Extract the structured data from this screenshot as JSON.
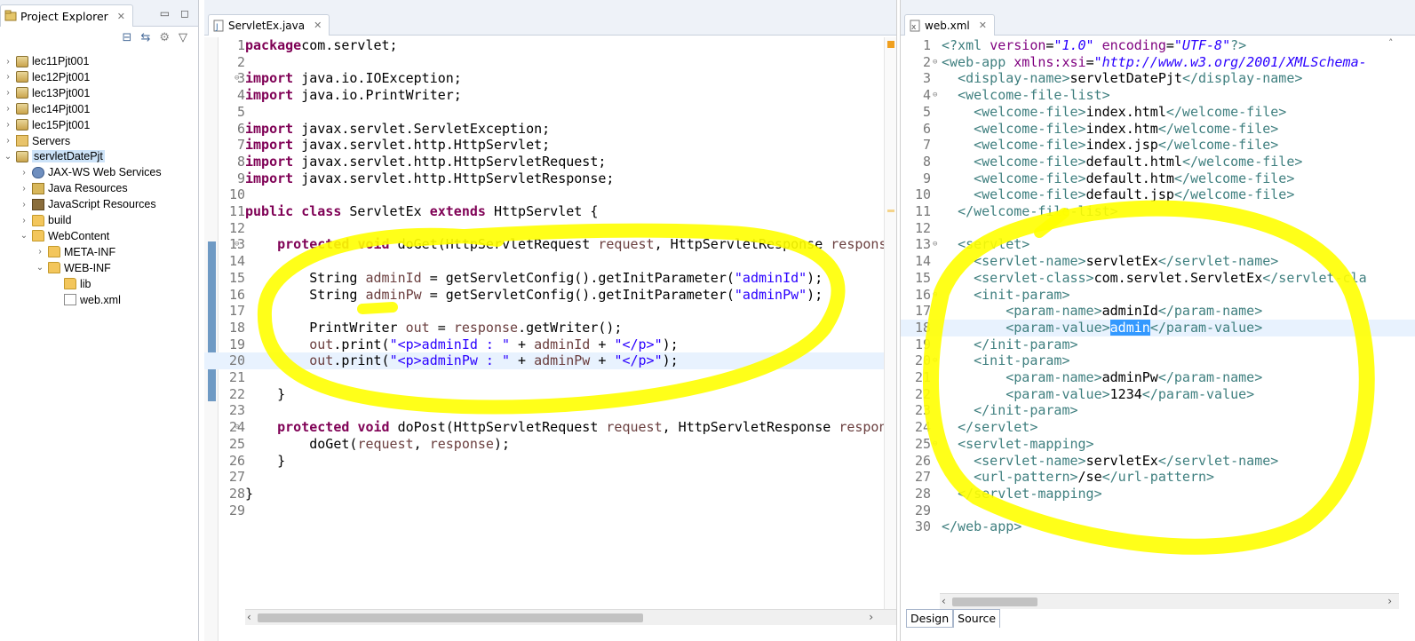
{
  "explorer": {
    "title": "Project Explorer",
    "items": [
      {
        "label": "lec11Pjt001",
        "arrow": ">",
        "icon": "project",
        "level": 0
      },
      {
        "label": "lec12Pjt001",
        "arrow": ">",
        "icon": "project",
        "level": 0
      },
      {
        "label": "lec13Pjt001",
        "arrow": ">",
        "icon": "project",
        "level": 0
      },
      {
        "label": "lec14Pjt001",
        "arrow": ">",
        "icon": "project",
        "level": 0
      },
      {
        "label": "lec15Pjt001",
        "arrow": ">",
        "icon": "project",
        "level": 0
      },
      {
        "label": "Servers",
        "arrow": ">",
        "icon": "servers",
        "level": 0
      },
      {
        "label": "servletDatePjt",
        "arrow": "v",
        "icon": "project",
        "level": 0,
        "selected": true
      },
      {
        "label": "JAX-WS Web Services",
        "arrow": ">",
        "icon": "jaxws",
        "level": 1
      },
      {
        "label": "Java Resources",
        "arrow": ">",
        "icon": "javares",
        "level": 1
      },
      {
        "label": "JavaScript Resources",
        "arrow": ">",
        "icon": "jsres",
        "level": 1
      },
      {
        "label": "build",
        "arrow": ">",
        "icon": "folder",
        "level": 1
      },
      {
        "label": "WebContent",
        "arrow": "v",
        "icon": "folder",
        "level": 1
      },
      {
        "label": "META-INF",
        "arrow": ">",
        "icon": "folder",
        "level": 2
      },
      {
        "label": "WEB-INF",
        "arrow": "v",
        "icon": "folder",
        "level": 2
      },
      {
        "label": "lib",
        "arrow": "",
        "icon": "folder",
        "level": 3
      },
      {
        "label": "web.xml",
        "arrow": "",
        "icon": "xmlfile",
        "level": 3
      }
    ]
  },
  "java_editor": {
    "tab_label": "ServletEx.java",
    "current_line": 20,
    "lines": [
      {
        "n": "1",
        "parts": [
          [
            "kw",
            "package"
          ],
          [
            "",
            "com.servlet;"
          ]
        ]
      },
      {
        "n": "2",
        "parts": []
      },
      {
        "n": "3",
        "fold": "⊖",
        "parts": [
          [
            "kw",
            "import"
          ],
          [
            "",
            " java.io.IOException;"
          ]
        ]
      },
      {
        "n": "4",
        "parts": [
          [
            "kw",
            "import"
          ],
          [
            "",
            " java.io.PrintWriter;"
          ]
        ]
      },
      {
        "n": "5",
        "parts": []
      },
      {
        "n": "6",
        "parts": [
          [
            "kw",
            "import"
          ],
          [
            "",
            " javax.servlet.ServletException;"
          ]
        ]
      },
      {
        "n": "7",
        "parts": [
          [
            "kw",
            "import"
          ],
          [
            "",
            " javax.servlet.http.HttpServlet;"
          ]
        ]
      },
      {
        "n": "8",
        "parts": [
          [
            "kw",
            "import"
          ],
          [
            "",
            " javax.servlet.http.HttpServletRequest;"
          ]
        ]
      },
      {
        "n": "9",
        "parts": [
          [
            "kw",
            "import"
          ],
          [
            "",
            " javax.servlet.http.HttpServletResponse;"
          ]
        ]
      },
      {
        "n": "10",
        "parts": []
      },
      {
        "n": "11",
        "parts": [
          [
            "kw",
            "public"
          ],
          [
            "",
            " "
          ],
          [
            "kw",
            "class"
          ],
          [
            "",
            " ServletEx "
          ],
          [
            "kw",
            "extends"
          ],
          [
            "",
            " HttpServlet {"
          ]
        ]
      },
      {
        "n": "12",
        "parts": []
      },
      {
        "n": "13",
        "fold": "⊖",
        "parts": [
          [
            "",
            "    "
          ],
          [
            "kw",
            "protected"
          ],
          [
            "",
            " "
          ],
          [
            "kw",
            "void"
          ],
          [
            "",
            " doGet(HttpServletRequest "
          ],
          [
            "var",
            "request"
          ],
          [
            "",
            ", HttpServletResponse "
          ],
          [
            "var",
            "respons"
          ]
        ]
      },
      {
        "n": "14",
        "parts": []
      },
      {
        "n": "15",
        "parts": [
          [
            "",
            "        String "
          ],
          [
            "var",
            "adminId"
          ],
          [
            "",
            " = getServletConfig().getInitParameter("
          ],
          [
            "str",
            "\"adminId\""
          ],
          [
            "",
            ");"
          ]
        ]
      },
      {
        "n": "16",
        "parts": [
          [
            "",
            "        String "
          ],
          [
            "var",
            "adminPw"
          ],
          [
            "",
            " = getServletConfig().getInitParameter("
          ],
          [
            "str",
            "\"adminPw\""
          ],
          [
            "",
            ");"
          ]
        ]
      },
      {
        "n": "17",
        "parts": []
      },
      {
        "n": "18",
        "parts": [
          [
            "",
            "        PrintWriter "
          ],
          [
            "var",
            "out"
          ],
          [
            "",
            " = "
          ],
          [
            "var",
            "response"
          ],
          [
            "",
            ".getWriter();"
          ]
        ]
      },
      {
        "n": "19",
        "parts": [
          [
            "",
            "        "
          ],
          [
            "var",
            "out"
          ],
          [
            "",
            ".print("
          ],
          [
            "str",
            "\"<p>adminId : \""
          ],
          [
            "",
            " + "
          ],
          [
            "var",
            "adminId"
          ],
          [
            "",
            " + "
          ],
          [
            "str",
            "\"</p>\""
          ],
          [
            "",
            ");"
          ]
        ]
      },
      {
        "n": "20",
        "parts": [
          [
            "",
            "        "
          ],
          [
            "var",
            "out"
          ],
          [
            "",
            ".print("
          ],
          [
            "str",
            "\"<p>adminPw : \""
          ],
          [
            "",
            " + "
          ],
          [
            "var",
            "adminPw"
          ],
          [
            "",
            " + "
          ],
          [
            "str",
            "\"</p>\""
          ],
          [
            "",
            ");"
          ]
        ]
      },
      {
        "n": "21",
        "parts": []
      },
      {
        "n": "22",
        "parts": [
          [
            "",
            "    }"
          ]
        ]
      },
      {
        "n": "23",
        "parts": []
      },
      {
        "n": "24",
        "fold": "⊖",
        "parts": [
          [
            "",
            "    "
          ],
          [
            "kw",
            "protected"
          ],
          [
            "",
            " "
          ],
          [
            "kw",
            "void"
          ],
          [
            "",
            " doPost(HttpServletRequest "
          ],
          [
            "var",
            "request"
          ],
          [
            "",
            ", HttpServletResponse "
          ],
          [
            "var",
            "respon"
          ]
        ]
      },
      {
        "n": "25",
        "parts": [
          [
            "",
            "        doGet("
          ],
          [
            "var",
            "request"
          ],
          [
            "",
            ", "
          ],
          [
            "var",
            "response"
          ],
          [
            "",
            ");"
          ]
        ]
      },
      {
        "n": "26",
        "parts": [
          [
            "",
            "    }"
          ]
        ]
      },
      {
        "n": "27",
        "parts": []
      },
      {
        "n": "28",
        "parts": [
          [
            "",
            "}"
          ]
        ]
      },
      {
        "n": "29",
        "parts": []
      }
    ]
  },
  "xml_editor": {
    "tab_label": "web.xml",
    "current_line": 18,
    "bottom_tabs": [
      "Design",
      "Source"
    ],
    "lines": [
      {
        "n": "1",
        "parts": [
          [
            "tag",
            "<?xml"
          ],
          [
            "",
            " "
          ],
          [
            "attr",
            "version"
          ],
          [
            "",
            "="
          ],
          [
            "aval",
            "\"1.0\""
          ],
          [
            "",
            " "
          ],
          [
            "attr",
            "encoding"
          ],
          [
            "",
            "="
          ],
          [
            "aval",
            "\"UTF-8\""
          ],
          [
            "tag",
            "?>"
          ]
        ]
      },
      {
        "n": "2",
        "fold": "⊖",
        "parts": [
          [
            "tag",
            "<web-app"
          ],
          [
            "",
            " "
          ],
          [
            "attr",
            "xmlns:xsi"
          ],
          [
            "",
            "="
          ],
          [
            "aval",
            "\"http://www.w3.org/2001/XMLSchema-"
          ]
        ]
      },
      {
        "n": "3",
        "parts": [
          [
            "",
            "  "
          ],
          [
            "tag",
            "<display-name>"
          ],
          [
            "",
            "servletDatePjt"
          ],
          [
            "tag",
            "</display-name>"
          ]
        ]
      },
      {
        "n": "4",
        "fold": "⊖",
        "parts": [
          [
            "",
            "  "
          ],
          [
            "tag",
            "<welcome-file-list>"
          ]
        ]
      },
      {
        "n": "5",
        "parts": [
          [
            "",
            "    "
          ],
          [
            "tag",
            "<welcome-file>"
          ],
          [
            "",
            "index.html"
          ],
          [
            "tag",
            "</welcome-file>"
          ]
        ]
      },
      {
        "n": "6",
        "parts": [
          [
            "",
            "    "
          ],
          [
            "tag",
            "<welcome-file>"
          ],
          [
            "",
            "index.htm"
          ],
          [
            "tag",
            "</welcome-file>"
          ]
        ]
      },
      {
        "n": "7",
        "parts": [
          [
            "",
            "    "
          ],
          [
            "tag",
            "<welcome-file>"
          ],
          [
            "",
            "index.jsp"
          ],
          [
            "tag",
            "</welcome-file>"
          ]
        ]
      },
      {
        "n": "8",
        "parts": [
          [
            "",
            "    "
          ],
          [
            "tag",
            "<welcome-file>"
          ],
          [
            "",
            "default.html"
          ],
          [
            "tag",
            "</welcome-file>"
          ]
        ]
      },
      {
        "n": "9",
        "parts": [
          [
            "",
            "    "
          ],
          [
            "tag",
            "<welcome-file>"
          ],
          [
            "",
            "default.htm"
          ],
          [
            "tag",
            "</welcome-file>"
          ]
        ]
      },
      {
        "n": "10",
        "parts": [
          [
            "",
            "    "
          ],
          [
            "tag",
            "<welcome-file>"
          ],
          [
            "",
            "default.jsp"
          ],
          [
            "tag",
            "</welcome-file>"
          ]
        ]
      },
      {
        "n": "11",
        "parts": [
          [
            "",
            "  "
          ],
          [
            "tag",
            "</welcome-file-list>"
          ]
        ]
      },
      {
        "n": "12",
        "parts": []
      },
      {
        "n": "13",
        "fold": "⊖",
        "parts": [
          [
            "",
            "  "
          ],
          [
            "tag",
            "<servlet>"
          ]
        ]
      },
      {
        "n": "14",
        "parts": [
          [
            "",
            "    "
          ],
          [
            "tag",
            "<servlet-name>"
          ],
          [
            "",
            "servletEx"
          ],
          [
            "tag",
            "</servlet-name>"
          ]
        ]
      },
      {
        "n": "15",
        "parts": [
          [
            "",
            "    "
          ],
          [
            "tag",
            "<servlet-class>"
          ],
          [
            "",
            "com.servlet.ServletEx"
          ],
          [
            "tag",
            "</servlet-cla"
          ]
        ]
      },
      {
        "n": "16",
        "fold": "⊖",
        "parts": [
          [
            "",
            "    "
          ],
          [
            "tag",
            "<init-param>"
          ]
        ]
      },
      {
        "n": "17",
        "parts": [
          [
            "",
            "        "
          ],
          [
            "tag",
            "<param-name>"
          ],
          [
            "",
            "adminId"
          ],
          [
            "tag",
            "</param-name>"
          ]
        ]
      },
      {
        "n": "18",
        "parts": [
          [
            "",
            "        "
          ],
          [
            "tag",
            "<param-value>"
          ],
          [
            "sel",
            "admin"
          ],
          [
            "tag",
            "</param-value>"
          ]
        ]
      },
      {
        "n": "19",
        "parts": [
          [
            "",
            "    "
          ],
          [
            "tag",
            "</init-param>"
          ]
        ]
      },
      {
        "n": "20",
        "fold": "⊖",
        "parts": [
          [
            "",
            "    "
          ],
          [
            "tag",
            "<init-param>"
          ]
        ]
      },
      {
        "n": "21",
        "parts": [
          [
            "",
            "        "
          ],
          [
            "tag",
            "<param-name>"
          ],
          [
            "",
            "adminPw"
          ],
          [
            "tag",
            "</param-name>"
          ]
        ]
      },
      {
        "n": "22",
        "parts": [
          [
            "",
            "        "
          ],
          [
            "tag",
            "<param-value>"
          ],
          [
            "",
            "1234"
          ],
          [
            "tag",
            "</param-value>"
          ]
        ]
      },
      {
        "n": "23",
        "parts": [
          [
            "",
            "    "
          ],
          [
            "tag",
            "</init-param>"
          ]
        ]
      },
      {
        "n": "24",
        "parts": [
          [
            "",
            "  "
          ],
          [
            "tag",
            "</servlet>"
          ]
        ]
      },
      {
        "n": "25",
        "fold": "⊖",
        "parts": [
          [
            "",
            "  "
          ],
          [
            "tag",
            "<servlet-mapping>"
          ]
        ]
      },
      {
        "n": "26",
        "parts": [
          [
            "",
            "    "
          ],
          [
            "tag",
            "<servlet-name>"
          ],
          [
            "",
            "servletEx"
          ],
          [
            "tag",
            "</servlet-name>"
          ]
        ]
      },
      {
        "n": "27",
        "parts": [
          [
            "",
            "    "
          ],
          [
            "tag",
            "<url-pattern>"
          ],
          [
            "",
            "/se"
          ],
          [
            "tag",
            "</url-pattern>"
          ]
        ]
      },
      {
        "n": "28",
        "parts": [
          [
            "",
            "  "
          ],
          [
            "tag",
            "</servlet-mapping>"
          ]
        ]
      },
      {
        "n": "29",
        "parts": []
      },
      {
        "n": "30",
        "parts": [
          [
            "tag",
            "</web-app>"
          ]
        ]
      }
    ]
  },
  "colors": {
    "highlighter": "#ffff00",
    "keyword": "#7f0055",
    "string": "#2a00ff",
    "xml_tag": "#3f7f7f",
    "selection": "#3399ff"
  }
}
